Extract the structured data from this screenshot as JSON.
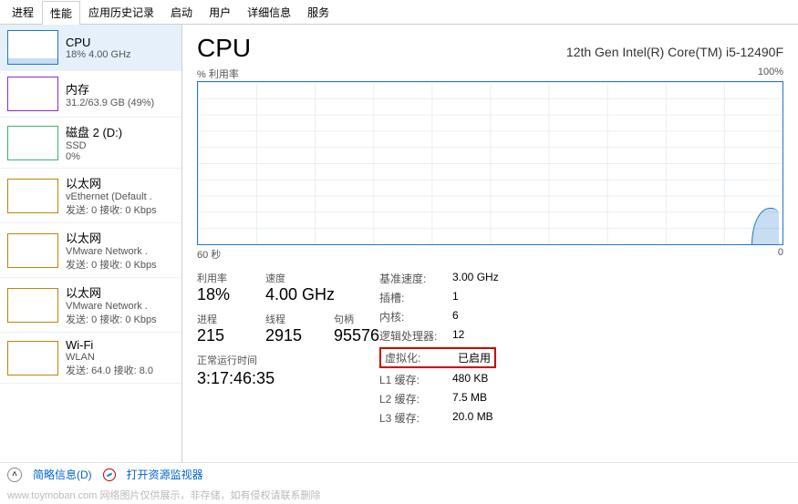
{
  "tabs": [
    "进程",
    "性能",
    "应用历史记录",
    "启动",
    "用户",
    "详细信息",
    "服务"
  ],
  "active_tab": 1,
  "sidebar": [
    {
      "title": "CPU",
      "sub": "18% 4.00 GHz",
      "cls": "thumb-cpu",
      "fill": 18
    },
    {
      "title": "内存",
      "sub": "31.2/63.9 GB (49%)",
      "cls": "thumb-mem"
    },
    {
      "title": "磁盘 2 (D:)",
      "sub": "SSD",
      "sub2": "0%",
      "cls": "thumb-disk"
    },
    {
      "title": "以太网",
      "sub": "vEthernet (Default .",
      "sub2": "发送: 0 接收: 0 Kbps",
      "cls": "thumb-eth"
    },
    {
      "title": "以太网",
      "sub": "VMware Network .",
      "sub2": "发送: 0 接收: 0 Kbps",
      "cls": "thumb-eth"
    },
    {
      "title": "以太网",
      "sub": "VMware Network .",
      "sub2": "发送: 0 接收: 0 Kbps",
      "cls": "thumb-eth"
    },
    {
      "title": "Wi-Fi",
      "sub": "WLAN",
      "sub2": "发送: 64.0 接收: 8.0",
      "cls": "thumb-wifi"
    }
  ],
  "header": {
    "title": "CPU",
    "model": "12th Gen Intel(R) Core(TM) i5-12490F"
  },
  "chart": {
    "ylabel": "% 利用率",
    "ymax": "100%",
    "xlabel_left": "60 秒",
    "xlabel_right": "0"
  },
  "stats_left": {
    "row1": [
      {
        "lbl": "利用率",
        "val": "18%"
      },
      {
        "lbl": "速度",
        "val": "4.00 GHz"
      }
    ],
    "row2": [
      {
        "lbl": "进程",
        "val": "215"
      },
      {
        "lbl": "线程",
        "val": "2915"
      },
      {
        "lbl": "句柄",
        "val": "95576"
      }
    ],
    "uptime_lbl": "正常运行时间",
    "uptime_val": "3:17:46:35"
  },
  "stats_right": [
    {
      "lbl": "基准速度:",
      "val": "3.00 GHz"
    },
    {
      "lbl": "插槽:",
      "val": "1"
    },
    {
      "lbl": "内核:",
      "val": "6"
    },
    {
      "lbl": "逻辑处理器:",
      "val": "12"
    },
    {
      "lbl": "虚拟化:",
      "val": "已启用",
      "highlight": true
    },
    {
      "lbl": "L1 缓存:",
      "val": "480 KB"
    },
    {
      "lbl": "L2 缓存:",
      "val": "7.5 MB"
    },
    {
      "lbl": "L3 缓存:",
      "val": "20.0 MB"
    }
  ],
  "footer": {
    "fewer": "简略信息(D)",
    "monitor": "打开资源监视器"
  },
  "watermark": "www.toymoban.com    网络图片仅供展示，非存储，如有侵权请联系删除"
}
